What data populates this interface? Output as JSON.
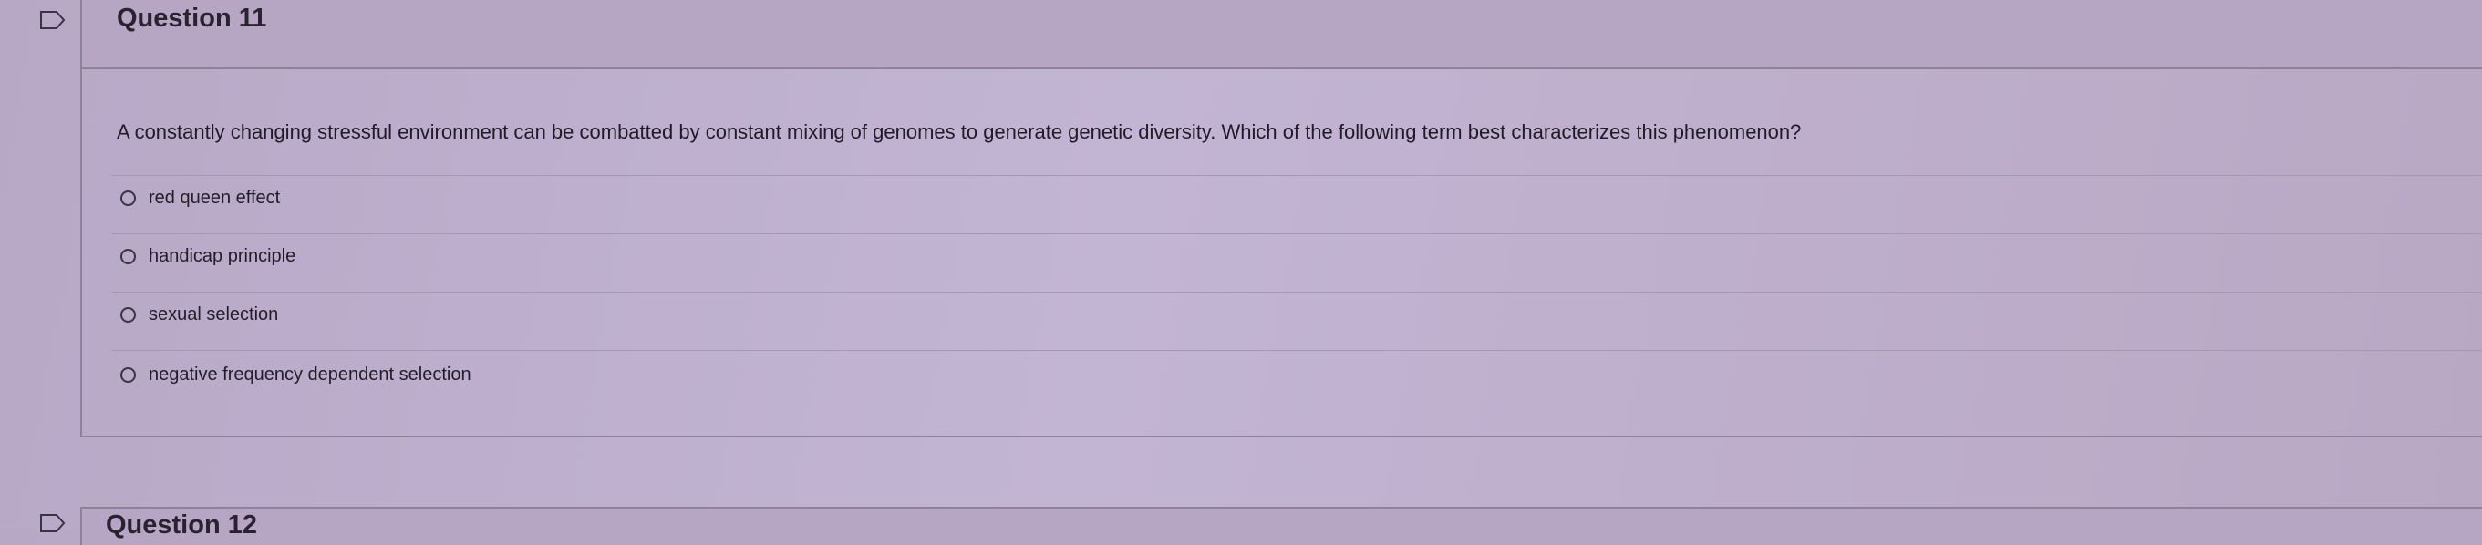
{
  "question": {
    "title": "Question 11",
    "text": "A constantly changing stressful environment can be combatted by constant mixing of genomes to generate genetic diversity. Which of the following term best characterizes this phenomenon?",
    "answers": [
      {
        "label": "red queen effect"
      },
      {
        "label": "handicap principle"
      },
      {
        "label": "sexual selection"
      },
      {
        "label": "negative frequency dependent selection"
      }
    ]
  },
  "next_question": {
    "title": "Question 12"
  },
  "icons": {
    "bookmark": "bookmark-flag-icon",
    "radio": "radio-unchecked-icon"
  }
}
